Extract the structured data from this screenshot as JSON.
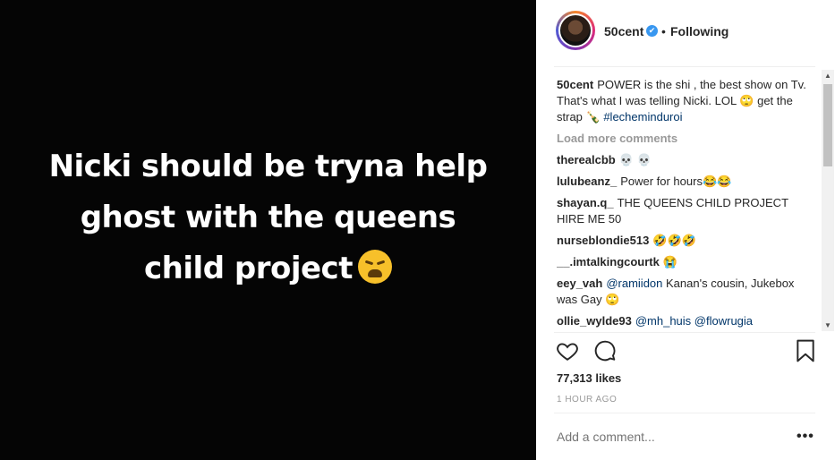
{
  "media": {
    "lines": [
      "Nicki should be tryna help",
      "ghost with the queens",
      "child project"
    ]
  },
  "header": {
    "username": "50cent",
    "separator": "•",
    "follow_status": "Following",
    "verified_icon": "✔"
  },
  "caption": {
    "user": "50cent",
    "text": "POWER is the shi , the best show on Tv. That's what I was telling Nicki. LOL 🙄 get the strap 🍾",
    "hashtag": "#lecheminduroi"
  },
  "load_more": "Load more comments",
  "comments": [
    {
      "user": "therealcbb",
      "text": "💀 💀"
    },
    {
      "user": "lulubeanz_",
      "text": "Power for hours😂😂"
    },
    {
      "user": "shayan.q_",
      "text": "THE QUEENS CHILD PROJECT HIRE ME 50"
    },
    {
      "user": "nurseblondie513",
      "text": "🤣🤣🤣"
    },
    {
      "user": "__.imtalkingcourtk",
      "text": "😭"
    },
    {
      "user": "eey_vah",
      "mention": "@ramiidon",
      "text": "Kanan's cousin, Jukebox was Gay 🙄"
    },
    {
      "user": "ollie_wylde93",
      "mention": "@mh_huis",
      "mention2": "@flowrugia"
    }
  ],
  "likes": "77,313 likes",
  "time": "1 HOUR AGO",
  "add_comment_placeholder": "Add a comment...",
  "more_label": "•••",
  "colors": {
    "link": "#003569",
    "verified": "#3897f0",
    "muted": "#999999"
  }
}
